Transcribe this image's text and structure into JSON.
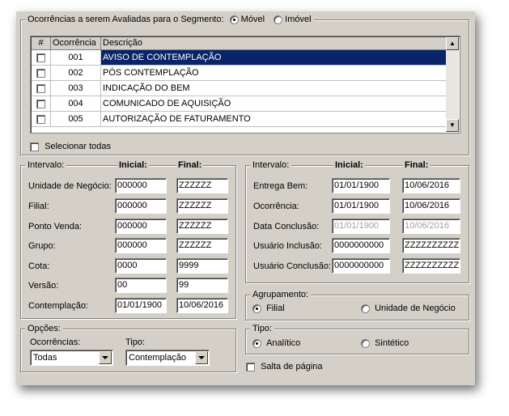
{
  "ocorrencias": {
    "legend_label": "Ocorrências a serem Avaliadas para o Segmento:",
    "segment_options": [
      {
        "label": "Móvel",
        "checked": true
      },
      {
        "label": "Imóvel",
        "checked": false
      }
    ],
    "columns": [
      "#",
      "Ocorrência",
      "Descrição"
    ],
    "rows": [
      {
        "code": "001",
        "desc": "AVISO DE CONTEMPLAÇÃO",
        "selected": true
      },
      {
        "code": "002",
        "desc": "PÓS CONTEMPLAÇÃO",
        "selected": false
      },
      {
        "code": "003",
        "desc": "INDICAÇÃO DO BEM",
        "selected": false
      },
      {
        "code": "004",
        "desc": "COMUNICADO DE AQUISIÇÃO",
        "selected": false
      },
      {
        "code": "005",
        "desc": "AUTORIZAÇÃO DE FATURAMENTO",
        "selected": false
      }
    ],
    "select_all_label": "Selecionar todas"
  },
  "intervalo_left": {
    "legend": "Intervalo:",
    "inicial_header": "Inicial:",
    "final_header": "Final:",
    "fields": [
      {
        "label": "Unidade de Negócio:",
        "inicial": "000000",
        "final": "ZZZZZZ"
      },
      {
        "label": "Filial:",
        "inicial": "000000",
        "final": "ZZZZZZ"
      },
      {
        "label": "Ponto Venda:",
        "inicial": "000000",
        "final": "ZZZZZZ"
      },
      {
        "label": "Grupo:",
        "inicial": "000000",
        "final": "ZZZZZZ"
      },
      {
        "label": "Cota:",
        "inicial": "0000",
        "final": "9999"
      },
      {
        "label": "Versão:",
        "inicial": "00",
        "final": "99"
      },
      {
        "label": "Contemplação:",
        "inicial": "01/01/1900",
        "final": "10/06/2016"
      }
    ]
  },
  "intervalo_right": {
    "legend": "Intervalo:",
    "inicial_header": "Inicial:",
    "final_header": "Final:",
    "fields": [
      {
        "label": "Entrega Bem:",
        "inicial": "01/01/1900",
        "final": "10/06/2016",
        "disabled": false
      },
      {
        "label": "Ocorrência:",
        "inicial": "01/01/1900",
        "final": "10/06/2016",
        "disabled": false
      },
      {
        "label": "Data Conclusão:",
        "inicial": "01/01/1900",
        "final": "10/06/2016",
        "disabled": true
      },
      {
        "label": "Usuário Inclusão:",
        "inicial": "0000000000",
        "final": "ZZZZZZZZZZ",
        "disabled": false
      },
      {
        "label": "Usuário Conclusão:",
        "inicial": "0000000000",
        "final": "ZZZZZZZZZZ",
        "disabled": false
      }
    ]
  },
  "agrupamento": {
    "legend": "Agrupamento:",
    "options": [
      {
        "label": "Filial",
        "checked": true
      },
      {
        "label": "Unidade de Negócio",
        "checked": false
      }
    ]
  },
  "opcoes": {
    "legend": "Opções:",
    "ocorrencias_label": "Ocorrências:",
    "ocorrencias_value": "Todas",
    "tipo_label": "Tipo:",
    "tipo_value": "Contemplação"
  },
  "tipo": {
    "legend": "Tipo:",
    "options": [
      {
        "label": "Analítico",
        "checked": true
      },
      {
        "label": "Sintético",
        "checked": false
      }
    ]
  },
  "salta_pagina_label": "Salta de página"
}
